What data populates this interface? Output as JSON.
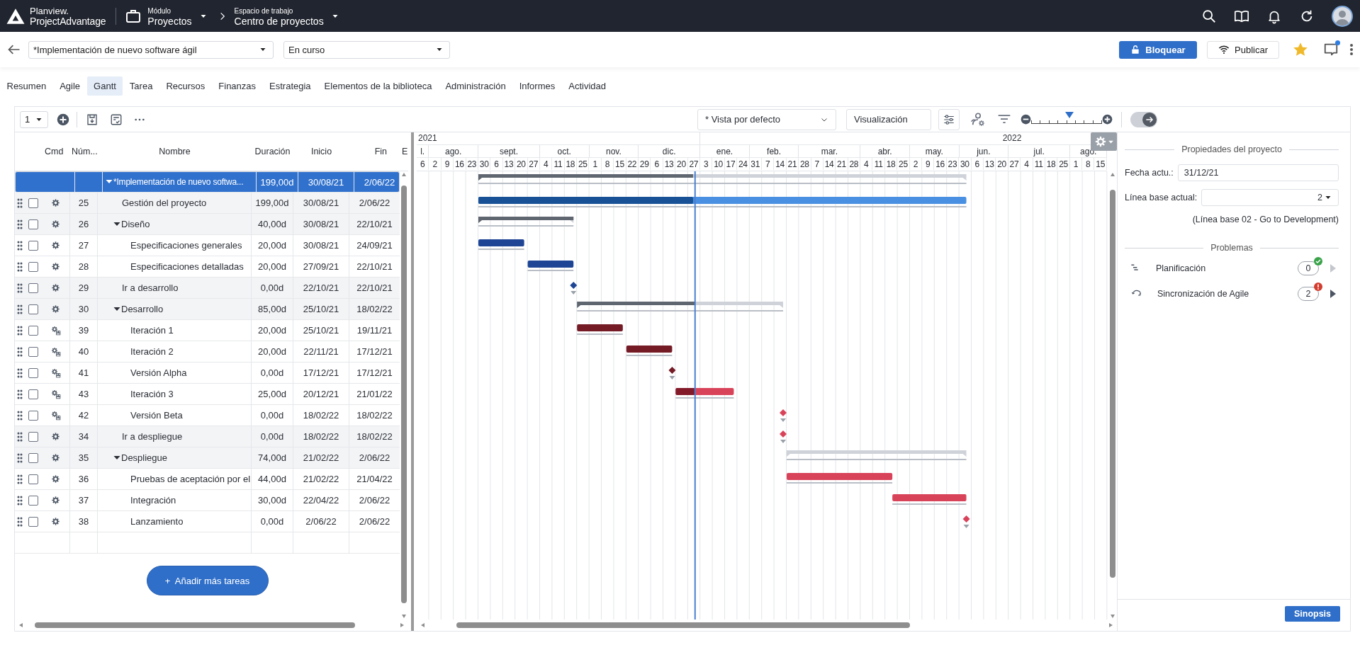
{
  "header": {
    "logo_top": "Planview.",
    "logo_bottom": "ProjectAdvantage",
    "module_label": "Módulo",
    "module": "Proyectos",
    "workspace_label": "Espacio de trabajo",
    "workspace": "Centro de proyectos"
  },
  "project_bar": {
    "project": "*Implementación de nuevo software ágil",
    "status": "En curso",
    "lock_button": "Bloquear",
    "publish_button": "Publicar",
    "favorite": true,
    "has_notification": true
  },
  "tabs": [
    {
      "label": "Resumen",
      "selected": false
    },
    {
      "label": "Agile",
      "selected": false
    },
    {
      "label": "Gantt",
      "selected": true
    },
    {
      "label": "Tarea",
      "selected": false
    },
    {
      "label": "Recursos",
      "selected": false
    },
    {
      "label": "Finanzas",
      "selected": false
    },
    {
      "label": "Estrategia",
      "selected": false
    },
    {
      "label": "Elementos de la biblioteca",
      "selected": false
    },
    {
      "label": "Administración",
      "selected": false
    },
    {
      "label": "Informes",
      "selected": false
    },
    {
      "label": "Actividad",
      "selected": false
    }
  ],
  "toolbar": {
    "level_select": "1",
    "view": "* Vista por defecto",
    "display": "Visualización",
    "zoom": {
      "level": 0.54
    },
    "toggle_on": true
  },
  "table": {
    "columns": [
      "Cmd",
      "Núm...",
      "Nombre",
      "Duración",
      "Inicio",
      "Fin",
      "E"
    ],
    "rows": [
      {
        "name": "*Implementación de nuevo softwa...",
        "duration": "199,00d",
        "start": "30/08/21",
        "end": "2/06/22",
        "kind": "summary",
        "level": 0.44,
        "expanded": true,
        "selected": true,
        "children": [
          {
            "num": "25",
            "name": "Gestión del proyecto",
            "duration": "199,00d",
            "start": "30/08/21",
            "end": "2/06/22",
            "kind": "task",
            "color": "#4a90e2",
            "level": 0.44,
            "agile": false,
            "checked": false,
            "selected": false
          },
          {
            "num": "26",
            "name": "Diseño",
            "duration": "40,00d",
            "start": "30/08/21",
            "end": "22/10/21",
            "kind": "summary",
            "level": 1,
            "expanded": true,
            "agile": false,
            "checked": false,
            "selected": false,
            "children": [
              {
                "num": "27",
                "name": "Especificaciones generales",
                "duration": "20,00d",
                "start": "30/08/21",
                "end": "24/09/21",
                "kind": "task",
                "color": "#1e4595",
                "agile": false,
                "checked": false,
                "selected": false
              },
              {
                "num": "28",
                "name": "Especificaciones detalladas",
                "duration": "20,00d",
                "start": "27/09/21",
                "end": "22/10/21",
                "kind": "task",
                "color": "#1e4595",
                "agile": false,
                "checked": false,
                "selected": false
              }
            ]
          },
          {
            "num": "29",
            "name": "Ir a desarrollo",
            "duration": "0,00d",
            "start": "22/10/21",
            "end": "22/10/21",
            "kind": "milestone",
            "color": "#1e4595",
            "agile": false,
            "checked": false,
            "selected": false
          },
          {
            "num": "30",
            "name": "Desarrollo",
            "duration": "85,00d",
            "start": "25/10/21",
            "end": "18/02/22",
            "kind": "summary",
            "level": 0.57,
            "expanded": true,
            "agile": false,
            "checked": false,
            "selected": false,
            "children": [
              {
                "num": "39",
                "name": "Iteración 1",
                "duration": "20,00d",
                "start": "25/10/21",
                "end": "19/11/21",
                "kind": "task",
                "color": "#741b26",
                "agile": true,
                "checked": false,
                "selected": false
              },
              {
                "num": "40",
                "name": "Iteración 2",
                "duration": "20,00d",
                "start": "22/11/21",
                "end": "17/12/21",
                "kind": "task",
                "color": "#741b26",
                "agile": true,
                "checked": false,
                "selected": false
              },
              {
                "num": "41",
                "name": "Versión Alpha",
                "duration": "0,00d",
                "start": "17/12/21",
                "end": "17/12/21",
                "kind": "milestone",
                "color": "#741b26",
                "agile": true,
                "checked": false,
                "selected": false
              },
              {
                "num": "43",
                "name": "Iteración 3",
                "duration": "25,00d",
                "start": "20/12/21",
                "end": "21/01/22",
                "kind": "task",
                "color": "#d9435a",
                "level": 0.33,
                "agile": true,
                "checked": false,
                "selected": false
              },
              {
                "num": "42",
                "name": "Versión Beta",
                "duration": "0,00d",
                "start": "18/02/22",
                "end": "18/02/22",
                "kind": "milestone",
                "color": "#d9435a",
                "agile": true,
                "checked": false,
                "selected": false
              }
            ]
          },
          {
            "num": "34",
            "name": "Ir a despliegue",
            "duration": "0,00d",
            "start": "18/02/22",
            "end": "18/02/22",
            "kind": "milestone",
            "color": "#d9435a",
            "agile": false,
            "checked": false,
            "selected": false
          },
          {
            "num": "35",
            "name": "Despliegue",
            "duration": "74,00d",
            "start": "21/02/22",
            "end": "2/06/22",
            "kind": "summary",
            "expanded": true,
            "agile": false,
            "checked": false,
            "selected": false,
            "children": [
              {
                "num": "36",
                "name": "Pruebas de aceptación por el",
                "duration": "44,00d",
                "start": "21/02/22",
                "end": "21/04/22",
                "kind": "task",
                "color": "#d9435a",
                "agile": false,
                "checked": false,
                "selected": false
              },
              {
                "num": "37",
                "name": "Integración",
                "duration": "30,00d",
                "start": "22/04/22",
                "end": "2/06/22",
                "kind": "task",
                "color": "#d9435a",
                "agile": false,
                "checked": false,
                "selected": false
              },
              {
                "num": "38",
                "name": "Lanzamiento",
                "duration": "0,00d",
                "start": "2/06/22",
                "end": "2/06/22",
                "kind": "milestone",
                "color": "#d9435a",
                "agile": false,
                "checked": false,
                "selected": false
              }
            ]
          }
        ]
      }
    ]
  },
  "add_button": "+  Añadir más tareas",
  "timeline": {
    "years": [
      {
        "label": "2021",
        "months": [
          {
            "label": "l.",
            "weeks": [
              "6"
            ]
          },
          {
            "label": "ago.",
            "weeks": [
              "2",
              "9",
              "16",
              "23"
            ]
          },
          {
            "label": "sept.",
            "weeks": [
              "30",
              "6",
              "13",
              "20",
              "27"
            ]
          },
          {
            "label": "oct.",
            "weeks": [
              "4",
              "11",
              "18",
              "25"
            ]
          },
          {
            "label": "nov.",
            "weeks": [
              "1",
              "8",
              "15",
              "22"
            ]
          },
          {
            "label": "dic.",
            "weeks": [
              "29",
              "6",
              "13",
              "20",
              "27"
            ]
          }
        ]
      },
      {
        "label": "2022",
        "months": [
          {
            "label": "ene.",
            "weeks": [
              "3",
              "10",
              "17",
              "24"
            ]
          },
          {
            "label": "feb.",
            "weeks": [
              "31",
              "7",
              "14",
              "21"
            ]
          },
          {
            "label": "mar.",
            "weeks": [
              "28",
              "7",
              "14",
              "21",
              "28"
            ]
          },
          {
            "label": "abr.",
            "weeks": [
              "4",
              "11",
              "18",
              "25"
            ]
          },
          {
            "label": "may.",
            "weeks": [
              "2",
              "9",
              "16",
              "23"
            ]
          },
          {
            "label": "jun.",
            "weeks": [
              "30",
              "6",
              "13",
              "20"
            ]
          },
          {
            "label": "jul.",
            "weeks": [
              "27",
              "4",
              "11",
              "18",
              "25"
            ]
          },
          {
            "label": "ago.",
            "weeks": [
              "1",
              "8",
              "15"
            ]
          }
        ]
      }
    ]
  },
  "side_panel": {
    "title": "Propiedades del proyecto",
    "status_date_label": "Fecha actu.:",
    "status_date": "31/12/21",
    "baseline_label": "Línea base actual:",
    "baseline": "2",
    "baseline_note": "(Línea base 02 - Go to Development)",
    "issues_title": "Problemas",
    "issues": [
      {
        "label": "Planificación",
        "count": "0",
        "kind": "ok",
        "disabled": true
      },
      {
        "label": "Sincronización de Agile",
        "count": "2",
        "kind": "error",
        "disabled": false
      }
    ],
    "summary_button": "Sinopsis"
  }
}
